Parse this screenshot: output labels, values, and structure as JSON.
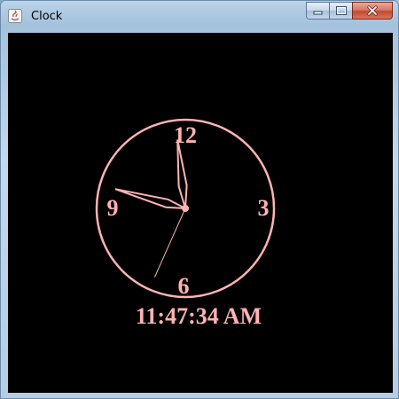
{
  "window": {
    "title": "Clock",
    "controls": {
      "minimize": "minimize",
      "maximize": "maximize",
      "close": "close"
    }
  },
  "clock": {
    "numerals": {
      "twelve": "12",
      "three": "3",
      "six": "6",
      "nine": "9"
    },
    "time": {
      "hours": 11,
      "minutes": 47,
      "seconds": 34
    },
    "digital_time": "11:47:34 AM",
    "color": "#ffb3b3",
    "background": "#000000"
  }
}
